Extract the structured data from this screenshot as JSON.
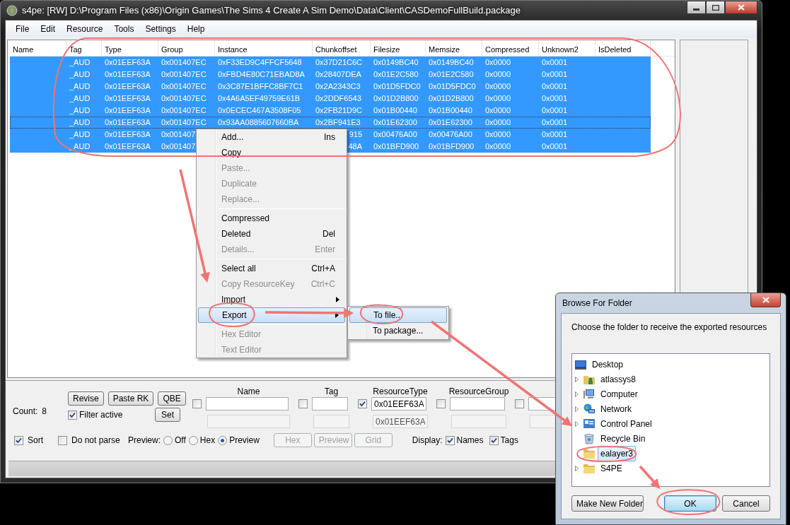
{
  "window": {
    "title": "s4pe: [RW] D:\\Program Files (x86)\\Origin Games\\The Sims 4 Create A Sim Demo\\Data\\Client\\CASDemoFullBuild.package"
  },
  "menu_bar": [
    "File",
    "Edit",
    "Resource",
    "Tools",
    "Settings",
    "Help"
  ],
  "table": {
    "columns": [
      "Name",
      "Tag",
      "Type",
      "Group",
      "Instance",
      "Chunkoffset",
      "Filesize",
      "Memsize",
      "Compressed",
      "Unknown2",
      "IsDeleted"
    ],
    "rows": [
      {
        "selected": true,
        "focused": false,
        "cells": [
          null,
          "_AUD",
          "0x01EEF63A",
          "0x001407EC",
          "0xF33ED9C4FFCF5648",
          "0x37D21C6C",
          "0x0149BC40",
          "0x0149BC40",
          "0x0000",
          "0x0001",
          null
        ]
      },
      {
        "selected": true,
        "focused": false,
        "cells": [
          null,
          "_AUD",
          "0x01EEF63A",
          "0x001407EC",
          "0xFBD4E80C71EBAD8A",
          "0x28407DEA",
          "0x01E2C580",
          "0x01E2C580",
          "0x0000",
          "0x0001",
          null
        ]
      },
      {
        "selected": true,
        "focused": false,
        "cells": [
          null,
          "_AUD",
          "0x01EEF63A",
          "0x001407EC",
          "0x3C87E1BFFC8BF7C1",
          "0x2A2343C3",
          "0x01D5FDC0",
          "0x01D5FDC0",
          "0x0000",
          "0x0001",
          null
        ]
      },
      {
        "selected": true,
        "focused": false,
        "cells": [
          null,
          "_AUD",
          "0x01EEF63A",
          "0x001407EC",
          "0x4A6A5EF49759E61B",
          "0x2DDF6543",
          "0x01D2B800",
          "0x01D2B800",
          "0x0000",
          "0x0001",
          null
        ]
      },
      {
        "selected": true,
        "focused": false,
        "cells": [
          null,
          "_AUD",
          "0x01EEF63A",
          "0x001407EC",
          "0x0ECEC467A3508F05",
          "0x2FB21D9C",
          "0x01B00440",
          "0x01B00440",
          "0x0000",
          "0x0001",
          null
        ]
      },
      {
        "selected": true,
        "focused": true,
        "cells": [
          null,
          "_AUD",
          "0x01EEF63A",
          "0x001407EC",
          "0x93AA0885607660BA",
          "0x2BF941E3",
          "0x01E62300",
          "0x01E62300",
          "0x0000",
          "0x0001",
          null
        ]
      },
      {
        "selected": true,
        "focused": false,
        "cells": [
          null,
          "_AUD",
          "0x01EEF63A",
          "0x001407",
          null,
          "915",
          "0x00476A00",
          "0x00476A00",
          "0x0000",
          "0x0001",
          null
        ]
      },
      {
        "selected": true,
        "focused": false,
        "cells": [
          null,
          "_AUD",
          "0x01EEF63A",
          "0x001407",
          null,
          "48A",
          "0x01BFD900",
          "0x01BFD900",
          "0x0000",
          "0x0001",
          null
        ]
      }
    ]
  },
  "context_menu": {
    "items": [
      {
        "kind": "item",
        "label": "Add...",
        "shortcut": "Ins",
        "disabled": false,
        "highlighted": false
      },
      {
        "kind": "item",
        "label": "Copy",
        "disabled": false,
        "highlighted": false
      },
      {
        "kind": "item",
        "label": "Paste...",
        "disabled": true,
        "highlighted": false
      },
      {
        "kind": "item",
        "label": "Duplicate",
        "disabled": true,
        "highlighted": false
      },
      {
        "kind": "item",
        "label": "Replace...",
        "disabled": true,
        "highlighted": false
      },
      {
        "kind": "separator"
      },
      {
        "kind": "item",
        "label": "Compressed",
        "disabled": false,
        "highlighted": false
      },
      {
        "kind": "item",
        "label": "Deleted",
        "shortcut": "Del",
        "disabled": false,
        "highlighted": false
      },
      {
        "kind": "item",
        "label": "Details...",
        "shortcut": "Enter",
        "disabled": true,
        "highlighted": false
      },
      {
        "kind": "separator"
      },
      {
        "kind": "item",
        "label": "Select all",
        "shortcut": "Ctrl+A",
        "disabled": false,
        "highlighted": false
      },
      {
        "kind": "item",
        "label": "Copy ResourceKey",
        "shortcut": "Ctrl+C",
        "disabled": true,
        "highlighted": false
      },
      {
        "kind": "submenu",
        "label": "Import",
        "disabled": false,
        "highlighted": false
      },
      {
        "kind": "submenu",
        "label": "Export",
        "disabled": false,
        "highlighted": true
      },
      {
        "kind": "separator"
      },
      {
        "kind": "item",
        "label": "Hex Editor",
        "disabled": true,
        "highlighted": false
      },
      {
        "kind": "item",
        "label": "Text Editor",
        "disabled": true,
        "highlighted": false
      }
    ]
  },
  "submenu": {
    "items": [
      {
        "label": "To file...",
        "highlighted": true
      },
      {
        "label": "To package...",
        "highlighted": false
      }
    ]
  },
  "filter_panel": {
    "count_label": "Count:",
    "count": "8",
    "buttons": [
      {
        "label": "Revise",
        "disabled": false
      },
      {
        "label": "Paste RK",
        "disabled": false
      },
      {
        "label": "QBE",
        "disabled": false
      }
    ],
    "filter_active": {
      "label": "Filter active",
      "checked": true
    },
    "set_button": {
      "label": "Set",
      "disabled": false
    },
    "filters": [
      {
        "label": "Name",
        "checked": false
      },
      {
        "label": "Tag",
        "checked": false
      },
      {
        "label": "ResourceType",
        "checked": true,
        "value": "0x01EEF63A",
        "value2": "0x01EEF63A"
      },
      {
        "label": "ResourceGroup",
        "checked": false
      },
      {
        "checked": false
      }
    ],
    "sort": {
      "label": "Sort",
      "checked": true
    },
    "do_not_parse": {
      "label": "Do not parse",
      "checked": false
    },
    "preview_label": "Preview:",
    "preview_options": [
      {
        "label": "Off",
        "selected": false
      },
      {
        "label": "Hex",
        "selected": false
      },
      {
        "label": "Preview",
        "selected": true
      }
    ],
    "view_buttons": [
      {
        "label": "Hex",
        "disabled": true
      },
      {
        "label": "Preview",
        "disabled": true
      },
      {
        "label": "Grid",
        "disabled": true
      }
    ],
    "display_label": "Display:",
    "display_options": [
      {
        "label": "Names",
        "checked": true
      },
      {
        "label": "Tags",
        "checked": true
      }
    ]
  },
  "dialog": {
    "title": "Browse For Folder",
    "prompt": "Choose the folder to receive the exported resources",
    "tree": [
      {
        "kind": "desktop",
        "label": "Desktop",
        "expandable": false,
        "selected": false
      },
      {
        "kind": "user",
        "label": "atlassys8",
        "expandable": true,
        "selected": false
      },
      {
        "kind": "computer",
        "label": "Computer",
        "expandable": true,
        "selected": false
      },
      {
        "kind": "network",
        "label": "Network",
        "expandable": true,
        "selected": false
      },
      {
        "kind": "control-panel",
        "label": "Control Panel",
        "expandable": true,
        "selected": false
      },
      {
        "kind": "recycle-bin",
        "label": "Recycle Bin",
        "expandable": false,
        "selected": false
      },
      {
        "kind": "folder",
        "label": "ealayer3",
        "expandable": false,
        "selected": true
      },
      {
        "kind": "folder",
        "label": "S4PE",
        "expandable": true,
        "selected": false
      }
    ],
    "buttons": [
      {
        "label": "Make New Folder",
        "default": false
      },
      {
        "label": "OK",
        "default": true
      },
      {
        "label": "Cancel",
        "default": false
      }
    ]
  }
}
